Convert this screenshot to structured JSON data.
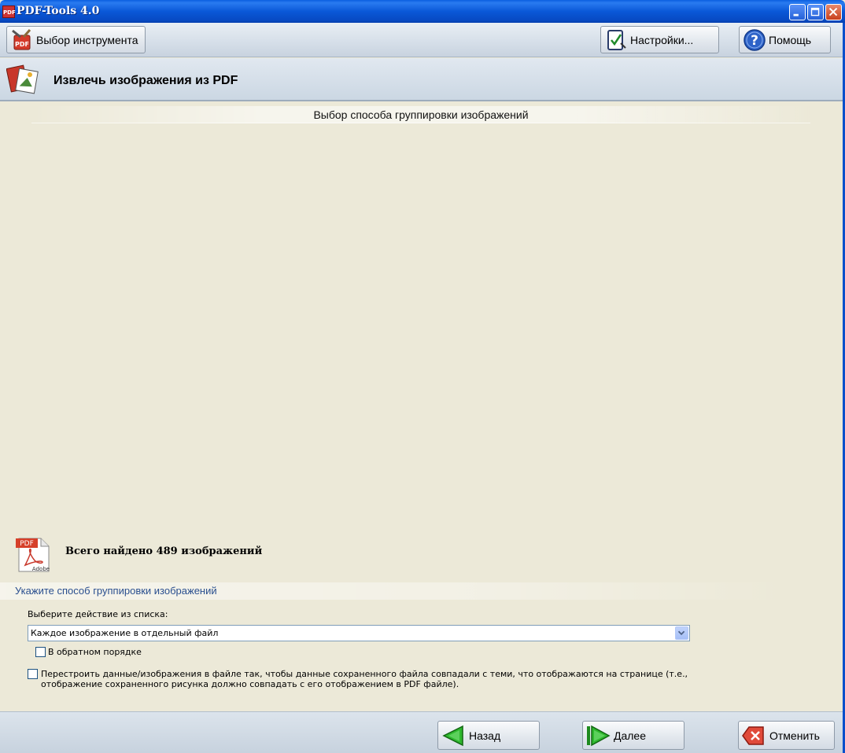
{
  "window": {
    "title": "PDF-Tools 4.0",
    "app_icon_text": "PDF"
  },
  "toolbar": {
    "tool_select_label": "Выбор инструмента",
    "settings_label": "Настройки...",
    "help_label": "Помощь"
  },
  "header": {
    "title": "Извлечь изображения из PDF"
  },
  "step": {
    "title": "Выбор способа группировки изображений"
  },
  "info": {
    "found_text": "Всего найдено 489 изображений",
    "pdf_icon_text": "PDF",
    "adobe_text": "Adobe"
  },
  "grouping": {
    "section_title": "Укажите способ группировки изображений",
    "select_label": "Выберите действие из списка:",
    "select_value": "Каждое изображение в отдельный файл",
    "reverse_label": "В обратном порядке",
    "reverse_checked": false,
    "rebuild_label": "Перестроить данные/изображения в файле так, чтобы данные сохраненного файла совпадали с теми, что отображаются на странице (т.е., отображение сохраненного рисунка должно совпадать с его отображением в PDF файле).",
    "rebuild_checked": false
  },
  "nav": {
    "back_label": "Назад",
    "next_label": "Далее",
    "cancel_label": "Отменить"
  },
  "colors": {
    "titlebar": "#0A58D8",
    "background": "#ECE9D8",
    "section_title": "#2A4F8F"
  }
}
